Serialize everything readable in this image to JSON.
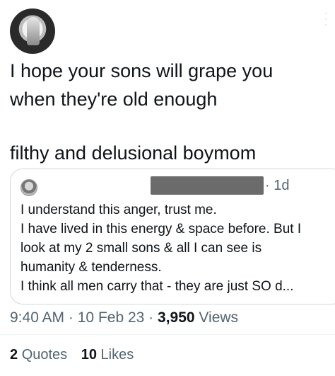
{
  "tweet": {
    "lines": [
      "I hope your sons will grape you",
      "when they're old enough"
    ],
    "second_paragraph": "filthy and delusional boymom"
  },
  "quote": {
    "time": "· 1d",
    "lines": [
      "I understand this anger, trust me.",
      "I have lived in this energy & space before. But I",
      "look at my 2 small sons & all I can see is",
      "humanity & tenderness.",
      "I think all men carry that - they are just SO d..."
    ]
  },
  "meta": {
    "time": "9:40 AM",
    "sep1": "·",
    "date": "10 Feb 23",
    "sep2": "·",
    "views_count": "3,950",
    "views_label": "Views"
  },
  "stats": {
    "quotes_count": "2",
    "quotes_label": "Quotes",
    "likes_count": "10",
    "likes_label": "Likes"
  }
}
